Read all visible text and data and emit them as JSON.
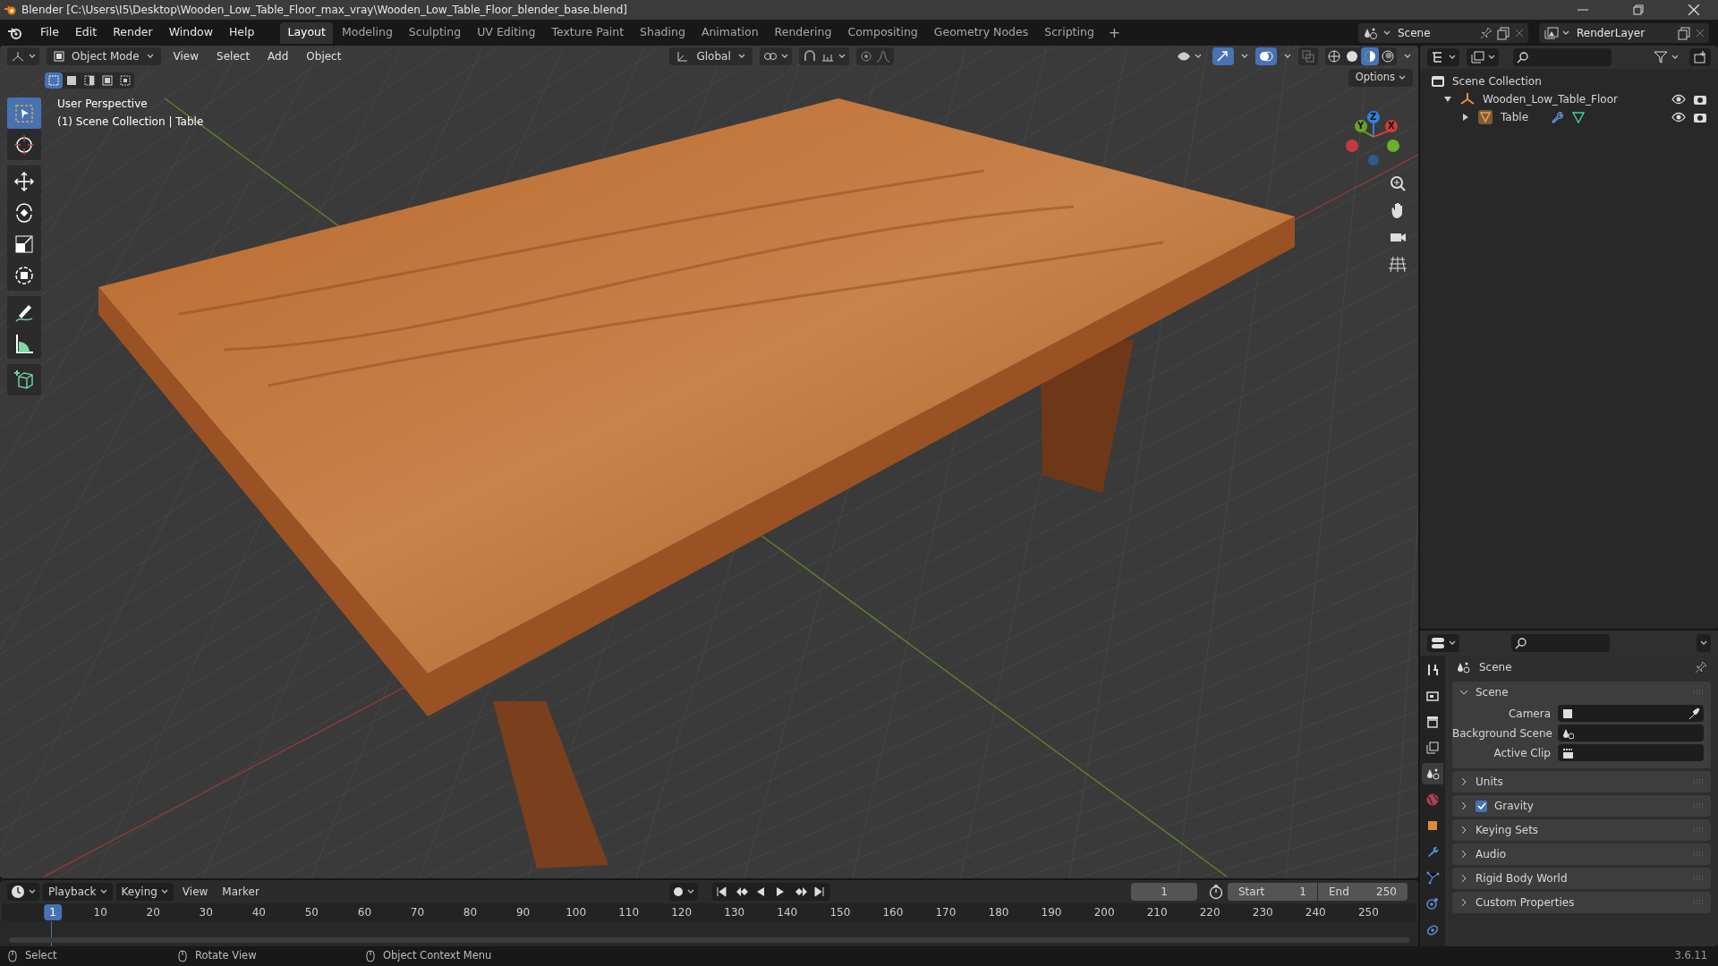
{
  "window": {
    "title": "Blender [C:\\Users\\I5\\Desktop\\Wooden_Low_Table_Floor_max_vray\\Wooden_Low_Table_Floor_blender_base.blend]"
  },
  "menu": [
    "File",
    "Edit",
    "Render",
    "Window",
    "Help"
  ],
  "workspaces": [
    {
      "label": "Layout",
      "selected": true
    },
    {
      "label": "Modeling",
      "selected": false
    },
    {
      "label": "Sculpting",
      "selected": false
    },
    {
      "label": "UV Editing",
      "selected": false
    },
    {
      "label": "Texture Paint",
      "selected": false
    },
    {
      "label": "Shading",
      "selected": false
    },
    {
      "label": "Animation",
      "selected": false
    },
    {
      "label": "Rendering",
      "selected": false
    },
    {
      "label": "Compositing",
      "selected": false
    },
    {
      "label": "Geometry Nodes",
      "selected": false
    },
    {
      "label": "Scripting",
      "selected": false
    }
  ],
  "add_workspace": "+",
  "scene_selector": {
    "value": "Scene"
  },
  "view_layer_selector": {
    "value": "RenderLayer"
  },
  "viewport": {
    "mode": "Object Mode",
    "menus": [
      "View",
      "Select",
      "Add",
      "Object"
    ],
    "select_modes": [
      {
        "selected": true
      },
      {
        "selected": false
      },
      {
        "selected": false
      },
      {
        "selected": false
      },
      {
        "selected": false
      }
    ],
    "orientation": "Global",
    "shading_modes": [
      {
        "kind": "wireframe",
        "selected": false
      },
      {
        "kind": "solid",
        "selected": false
      },
      {
        "kind": "material",
        "selected": true
      },
      {
        "kind": "rendered",
        "selected": false
      }
    ],
    "options": "Options",
    "overlay_lines": [
      "User Perspective",
      "(1) Scene Collection | Table"
    ],
    "gizmo_axes": [
      "Z",
      "Y",
      "X"
    ],
    "tools": [
      {
        "kind": "select",
        "selected": true
      },
      {
        "kind": "cursor",
        "selected": false
      },
      {
        "kind": "move",
        "selected": false
      },
      {
        "kind": "rotate",
        "selected": false
      },
      {
        "kind": "scale",
        "selected": false
      },
      {
        "kind": "transform",
        "selected": false
      },
      {
        "kind": "annotate",
        "selected": false
      },
      {
        "kind": "measure",
        "selected": false
      },
      {
        "kind": "add-cube",
        "selected": false
      }
    ]
  },
  "outliner": {
    "root": "Scene Collection",
    "items": [
      {
        "label": "Wooden_Low_Table_Floor",
        "kind": "empty",
        "expanded": true,
        "children": [
          {
            "label": "Table",
            "kind": "mesh",
            "expanded": false
          }
        ]
      }
    ]
  },
  "properties": {
    "tabs": [
      {
        "kind": "tool",
        "selected": false
      },
      {
        "kind": "render",
        "selected": false
      },
      {
        "kind": "output",
        "selected": false
      },
      {
        "kind": "view-layer",
        "selected": false
      },
      {
        "kind": "scene",
        "selected": true
      },
      {
        "kind": "world",
        "selected": false
      },
      {
        "kind": "object",
        "selected": false
      },
      {
        "kind": "modifier",
        "selected": false
      },
      {
        "kind": "particles",
        "selected": false
      },
      {
        "kind": "physics",
        "selected": false
      },
      {
        "kind": "constraint",
        "selected": false
      }
    ],
    "context": "Scene",
    "panels": [
      {
        "label": "Scene",
        "expanded": true,
        "fields": [
          "Camera",
          "Background Scene",
          "Active Clip"
        ]
      },
      {
        "label": "Units",
        "expanded": false
      },
      {
        "label": "Gravity",
        "expanded": false,
        "checked": true
      },
      {
        "label": "Keying Sets",
        "expanded": false
      },
      {
        "label": "Audio",
        "expanded": false
      },
      {
        "label": "Rigid Body World",
        "expanded": false
      },
      {
        "label": "Custom Properties",
        "expanded": false
      }
    ]
  },
  "timeline": {
    "menus": [
      "Playback",
      "Keying",
      "View",
      "Marker"
    ],
    "current_frame": "1",
    "start_label": "Start",
    "start": "1",
    "end_label": "End",
    "end": "250",
    "ruler": [
      {
        "label": "1",
        "selected": true
      },
      {
        "label": "10",
        "selected": false
      },
      {
        "label": "20",
        "selected": false
      },
      {
        "label": "30",
        "selected": false
      },
      {
        "label": "40",
        "selected": false
      },
      {
        "label": "50",
        "selected": false
      },
      {
        "label": "60",
        "selected": false
      },
      {
        "label": "70",
        "selected": false
      },
      {
        "label": "80",
        "selected": false
      },
      {
        "label": "90",
        "selected": false
      },
      {
        "label": "100",
        "selected": false
      },
      {
        "label": "110",
        "selected": false
      },
      {
        "label": "120",
        "selected": false
      },
      {
        "label": "130",
        "selected": false
      },
      {
        "label": "140",
        "selected": false
      },
      {
        "label": "150",
        "selected": false
      },
      {
        "label": "160",
        "selected": false
      },
      {
        "label": "170",
        "selected": false
      },
      {
        "label": "180",
        "selected": false
      },
      {
        "label": "190",
        "selected": false
      },
      {
        "label": "200",
        "selected": false
      },
      {
        "label": "210",
        "selected": false
      },
      {
        "label": "220",
        "selected": false
      },
      {
        "label": "230",
        "selected": false
      },
      {
        "label": "240",
        "selected": false
      },
      {
        "label": "250",
        "selected": false
      }
    ]
  },
  "status_bar": {
    "hints": [
      "Select",
      "Rotate View",
      "Object Context Menu"
    ],
    "version": "3.6.11"
  }
}
